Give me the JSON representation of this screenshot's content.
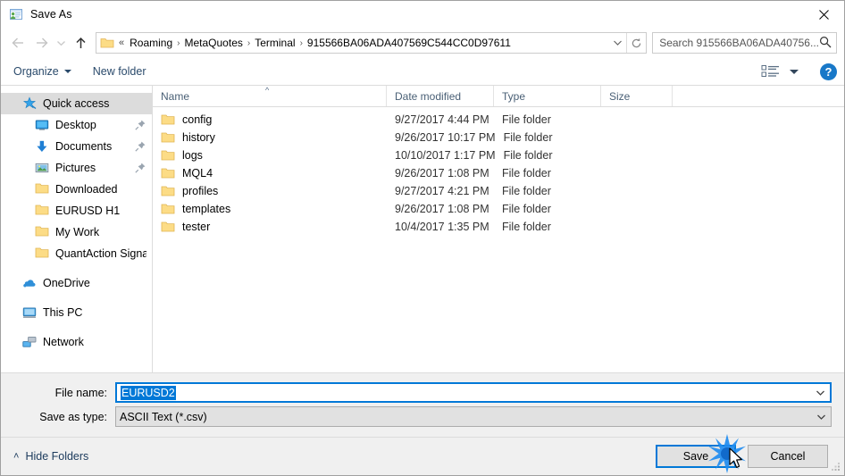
{
  "window": {
    "title": "Save As",
    "icon": "save-as-app-icon",
    "close_label": "✕"
  },
  "navbar": {
    "back_icon": "arrow-left-icon",
    "forward_icon": "arrow-right-icon",
    "recent_icon": "chevron-down-icon",
    "up_icon": "arrow-up-icon",
    "address": {
      "folder_icon": "folder-icon",
      "prefix": "«",
      "crumbs": [
        "Roaming",
        "MetaQuotes",
        "Terminal",
        "915566BA06ADA407569C544CC0D97611"
      ],
      "separator": "›",
      "dropdown_icon": "chevron-down-icon",
      "refresh_icon": "refresh-icon"
    },
    "search": {
      "placeholder": "Search 915566BA06ADA40756...",
      "icon": "search-icon"
    }
  },
  "commandbar": {
    "organize_label": "Organize",
    "new_folder_label": "New folder",
    "view_icon": "view-mode-icon",
    "help_label": "?"
  },
  "sidebar": {
    "groups": [
      {
        "header": {
          "label": "Quick access",
          "icon": "quick-access-star-icon",
          "selected": true
        },
        "items": [
          {
            "label": "Desktop",
            "icon": "desktop-icon",
            "pinned": true
          },
          {
            "label": "Documents",
            "icon": "documents-download-icon",
            "pinned": true
          },
          {
            "label": "Pictures",
            "icon": "pictures-icon",
            "pinned": true
          },
          {
            "label": "Downloaded",
            "icon": "folder-icon",
            "pinned": false
          },
          {
            "label": "EURUSD H1",
            "icon": "folder-icon",
            "pinned": false
          },
          {
            "label": "My Work",
            "icon": "folder-icon",
            "pinned": false
          },
          {
            "label": "QuantAction Signal",
            "icon": "folder-icon",
            "pinned": false
          }
        ]
      }
    ],
    "roots": [
      {
        "label": "OneDrive",
        "icon": "onedrive-cloud-icon"
      },
      {
        "label": "This PC",
        "icon": "this-pc-icon"
      },
      {
        "label": "Network",
        "icon": "network-icon"
      }
    ]
  },
  "filelist": {
    "columns": [
      "Name",
      "Date modified",
      "Type",
      "Size"
    ],
    "sort_column": "Name",
    "sort_direction": "ascending",
    "rows": [
      {
        "name": "config",
        "date": "9/27/2017 4:44 PM",
        "type": "File folder",
        "size": "",
        "icon": "folder-icon"
      },
      {
        "name": "history",
        "date": "9/26/2017 10:17 PM",
        "type": "File folder",
        "size": "",
        "icon": "folder-icon"
      },
      {
        "name": "logs",
        "date": "10/10/2017 1:17 PM",
        "type": "File folder",
        "size": "",
        "icon": "folder-icon"
      },
      {
        "name": "MQL4",
        "date": "9/26/2017 1:08 PM",
        "type": "File folder",
        "size": "",
        "icon": "folder-icon"
      },
      {
        "name": "profiles",
        "date": "9/27/2017 4:21 PM",
        "type": "File folder",
        "size": "",
        "icon": "folder-icon"
      },
      {
        "name": "templates",
        "date": "9/26/2017 1:08 PM",
        "type": "File folder",
        "size": "",
        "icon": "folder-icon"
      },
      {
        "name": "tester",
        "date": "10/4/2017 1:35 PM",
        "type": "File folder",
        "size": "",
        "icon": "folder-icon"
      }
    ]
  },
  "fields": {
    "filename_label": "File name:",
    "filename_value": "EURUSD2",
    "filetype_label": "Save as type:",
    "filetype_value": "ASCII Text (*.csv)",
    "chevron_icon": "chevron-down-icon"
  },
  "footer": {
    "hide_folders_label": "Hide Folders",
    "hide_folders_caret": "˄",
    "save_label": "Save",
    "cancel_label": "Cancel"
  },
  "colors": {
    "accent": "#0078d7",
    "command_text": "#2a4a6b",
    "help_blue": "#1878c8",
    "folder_yellow": "#fcdc86",
    "selection_gray": "#dcdcdc",
    "footer_bg": "#f0f0f0"
  }
}
